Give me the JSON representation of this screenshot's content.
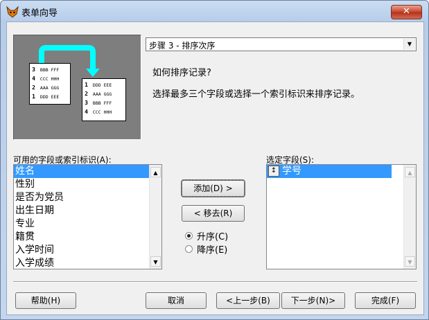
{
  "window": {
    "title": "表单向导",
    "close_glyph": "✕"
  },
  "step": {
    "selected": "步骤 3 - 排序次序",
    "dropdown_glyph": "▼"
  },
  "heading": "如何排序记录?",
  "instruction": "选择最多三个字段或选择一个索引标识来排序记录。",
  "illustration": {
    "left_sheet": [
      {
        "n": "3",
        "t": "BBB FFF"
      },
      {
        "n": "4",
        "t": "CCC HHH"
      },
      {
        "n": "2",
        "t": "AAA GGG"
      },
      {
        "n": "1",
        "t": "DDD EEE"
      }
    ],
    "right_sheet": [
      {
        "n": "1",
        "t": "DDD EEE"
      },
      {
        "n": "2",
        "t": "AAA GGG"
      },
      {
        "n": "3",
        "t": "BBB FFF"
      },
      {
        "n": "4",
        "t": "CCC HHH"
      }
    ],
    "arrow_color": "#00ffff"
  },
  "available": {
    "label": "可用的字段或索引标识(A):",
    "items": [
      "姓名",
      "性别",
      "是否为党员",
      "出生日期",
      "专业",
      "籍贯",
      "入学时间",
      "入学成绩"
    ],
    "selected_index": 0
  },
  "selected": {
    "label": "选定字段(S):",
    "items": [
      {
        "glyph": "↕",
        "text": "学号"
      }
    ]
  },
  "buttons": {
    "add": "添加(D) >",
    "remove": "< 移去(R)",
    "help": "帮助(H)",
    "cancel": "取消",
    "back": "<上一步(B)",
    "next": "下一步(N)>",
    "finish": "完成(F)"
  },
  "order": {
    "asc": "升序(C)",
    "desc": "降序(E)",
    "selected": "asc"
  },
  "colors": {
    "selection": "#3399ff",
    "close_button": "#c7432a"
  }
}
